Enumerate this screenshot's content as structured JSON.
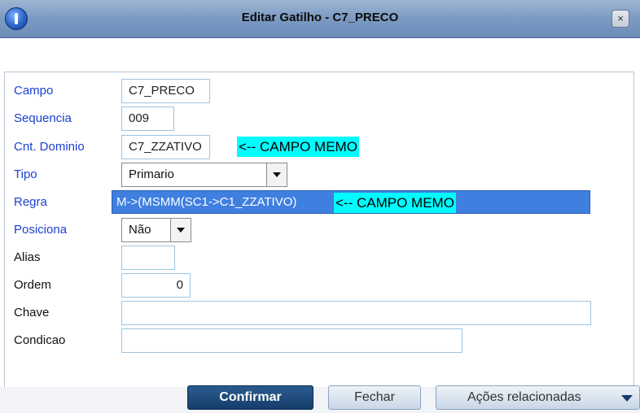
{
  "window": {
    "title": "Editar Gatilho - C7_PRECO",
    "close_glyph": "×"
  },
  "form": {
    "campo": {
      "label": "Campo",
      "value": "C7_PRECO"
    },
    "sequencia": {
      "label": "Sequencia",
      "value": "009"
    },
    "cnt_dominio": {
      "label": "Cnt. Dominio",
      "value": "C7_ZZATIVO",
      "note": "<-- CAMPO MEMO"
    },
    "tipo": {
      "label": "Tipo",
      "value": "Primario"
    },
    "regra": {
      "label": "Regra",
      "value": "M->(MSMM(SC1->C1_ZZATIVO)",
      "note": "<-- CAMPO MEMO"
    },
    "posiciona": {
      "label": "Posiciona",
      "value": "Não"
    },
    "alias": {
      "label": "Alias",
      "value": ""
    },
    "ordem": {
      "label": "Ordem",
      "value": "0"
    },
    "chave": {
      "label": "Chave",
      "value": ""
    },
    "condicao": {
      "label": "Condicao",
      "value": ""
    }
  },
  "buttons": {
    "confirm": "Confirmar",
    "close": "Fechar",
    "actions": "Ações relacionadas"
  },
  "colors": {
    "required_label": "#1a3fd1",
    "highlight_note": "#00fcfc",
    "selected_field": "#3f7fe0",
    "confirm_button": "#1f4a7a"
  }
}
